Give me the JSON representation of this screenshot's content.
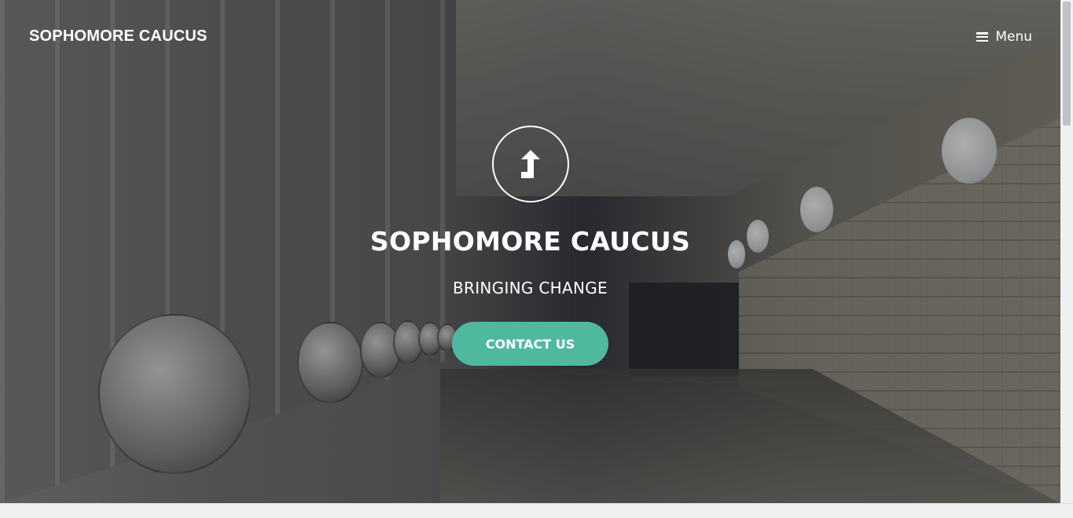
{
  "header": {
    "brand": "SOPHOMORE CAUCUS",
    "menu_label": "Menu",
    "menu_icon": "hamburger-icon"
  },
  "hero": {
    "icon": "arrow-turn-up-icon",
    "title": "SOPHOMORE CAUCUS",
    "subtitle": "BRINGING CHANGE",
    "cta_label": "CONTACT US"
  },
  "colors": {
    "accent": "#4fb99f",
    "text": "#ffffff"
  }
}
